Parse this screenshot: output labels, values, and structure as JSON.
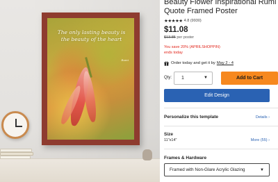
{
  "product": {
    "title": "Beauty Flower Inspirational Rumi Quote Framed Poster",
    "stars": "★★★★★",
    "rating_text": "4.8 (9930)",
    "price": "$11.08",
    "original_price": "$13.85",
    "price_unit": "per poster",
    "promo_line1": "You save 20% (APRILSHOPPIN)",
    "promo_line2": "ends today"
  },
  "artwork": {
    "quote": "The only lasting beauty is the beauty of the heart",
    "author": "Rumi"
  },
  "delivery": {
    "text": "Order today and get it by",
    "date": "May 2 - 4"
  },
  "purchase": {
    "qty_label": "Qty:",
    "qty_value": "1",
    "add_to_cart": "Add to Cart",
    "edit_design": "Edit Design"
  },
  "personalize": {
    "title": "Personalize this template",
    "details_link": "Details"
  },
  "size": {
    "title": "Size",
    "value": "11\"x14\"",
    "more_link": "More (55)"
  },
  "frames": {
    "title": "Frames & Hardware",
    "selected": "Framed with Non-Glare Acrylic Glazing"
  },
  "colors": {
    "accent_orange": "#f6881f",
    "accent_blue": "#2a62b3",
    "promo_red": "#e1251b",
    "frame_red": "#8e3b2f"
  }
}
